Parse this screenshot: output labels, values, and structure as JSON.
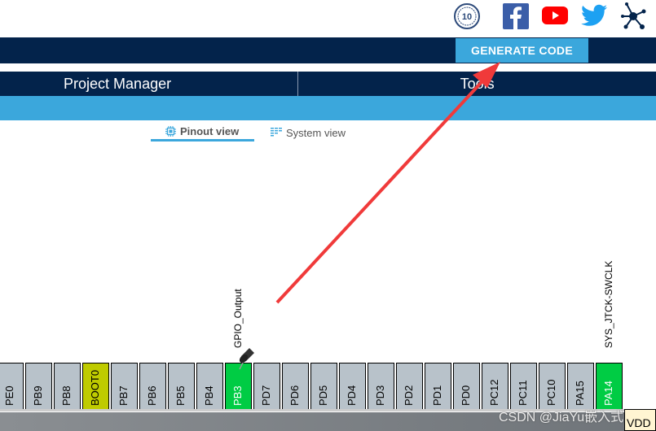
{
  "header": {
    "icons": [
      "anniversary-10-years-icon",
      "facebook-icon",
      "youtube-icon",
      "twitter-icon",
      "network-icon"
    ],
    "generate_code": "GENERATE CODE"
  },
  "nav": {
    "items": [
      {
        "label": "Project Manager"
      },
      {
        "label": "Tools"
      }
    ]
  },
  "tabs": [
    {
      "label": "Pinout view",
      "active": true
    },
    {
      "label": "System view",
      "active": false
    }
  ],
  "pins": [
    {
      "name": "PE0",
      "state": "default"
    },
    {
      "name": "PB9",
      "state": "default"
    },
    {
      "name": "PB8",
      "state": "default"
    },
    {
      "name": "BOOT0",
      "state": "boot"
    },
    {
      "name": "PB7",
      "state": "default"
    },
    {
      "name": "PB6",
      "state": "default"
    },
    {
      "name": "PB5",
      "state": "default"
    },
    {
      "name": "PB4",
      "state": "default"
    },
    {
      "name": "PB3",
      "state": "configured",
      "signal": "GPIO_Output",
      "pinned": true
    },
    {
      "name": "PD7",
      "state": "default"
    },
    {
      "name": "PD6",
      "state": "default"
    },
    {
      "name": "PD5",
      "state": "default"
    },
    {
      "name": "PD4",
      "state": "default"
    },
    {
      "name": "PD3",
      "state": "default"
    },
    {
      "name": "PD2",
      "state": "default"
    },
    {
      "name": "PD1",
      "state": "default"
    },
    {
      "name": "PD0",
      "state": "default"
    },
    {
      "name": "PC12",
      "state": "default"
    },
    {
      "name": "PC11",
      "state": "default"
    },
    {
      "name": "PC10",
      "state": "default"
    },
    {
      "name": "PA15",
      "state": "default"
    },
    {
      "name": "PA14",
      "state": "configured",
      "signal": "SYS_JTCK-SWCLK"
    }
  ],
  "vdd_label": "VDD",
  "watermark": "CSDN @JiaYu嵌入式",
  "colors": {
    "navy": "#03234b",
    "accent": "#3ba7dc",
    "pin_default": "#b8c2ca",
    "pin_configured": "#00cc44",
    "pin_boot": "#bfcb00",
    "arrow": "#f03a3a"
  }
}
